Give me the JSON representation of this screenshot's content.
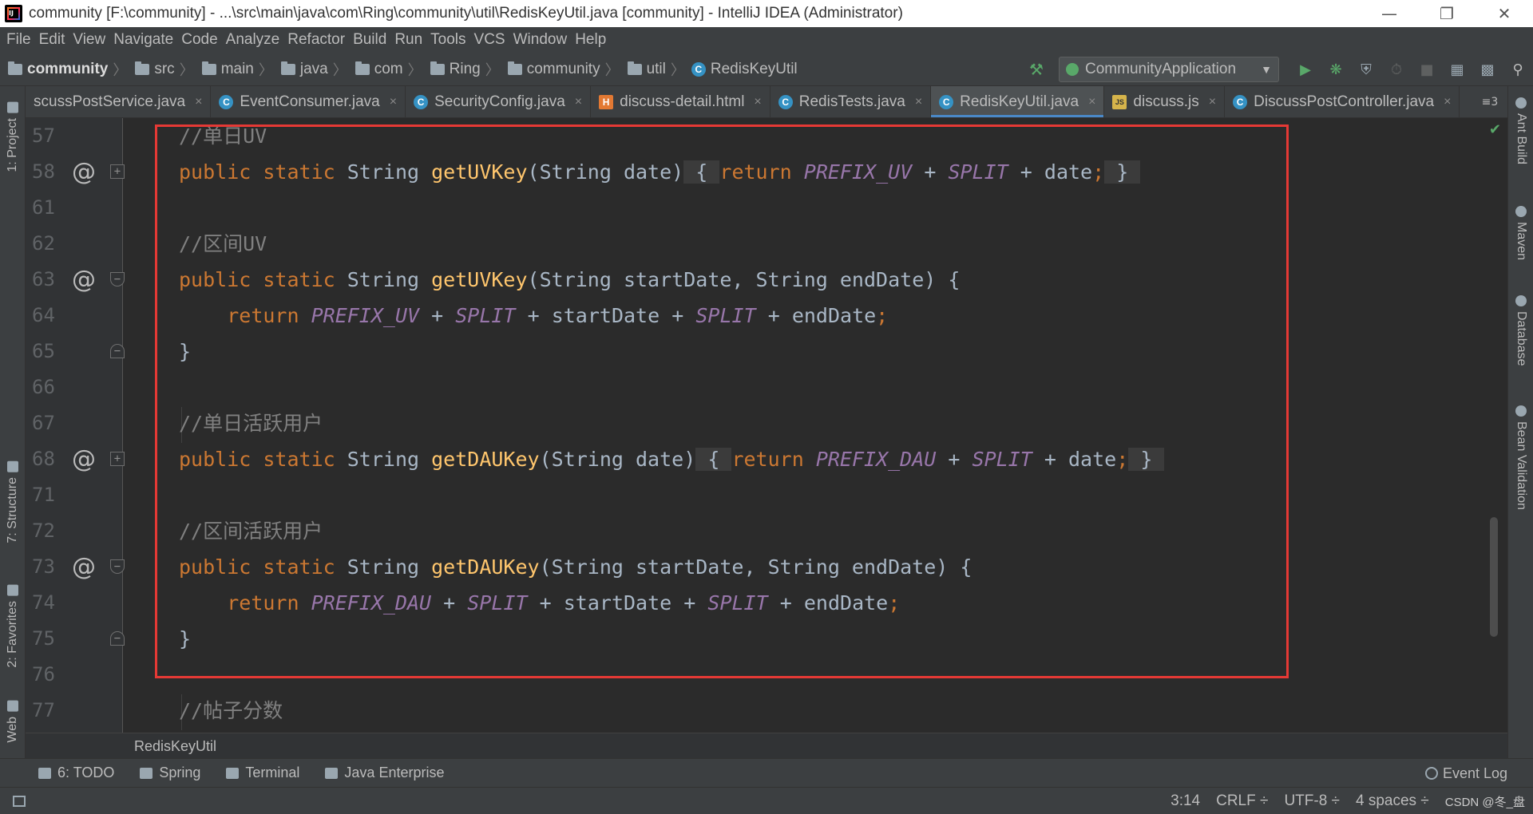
{
  "window": {
    "title": "community [F:\\community] - ...\\src\\main\\java\\com\\Ring\\community\\util\\RedisKeyUtil.java [community] - IntelliJ IDEA (Administrator)"
  },
  "menu": [
    "File",
    "Edit",
    "View",
    "Navigate",
    "Code",
    "Analyze",
    "Refactor",
    "Build",
    "Run",
    "Tools",
    "VCS",
    "Window",
    "Help"
  ],
  "breadcrumb": [
    "community",
    "src",
    "main",
    "java",
    "com",
    "Ring",
    "community",
    "util",
    "RedisKeyUtil"
  ],
  "run_config": "CommunityApplication",
  "tabs": [
    {
      "label": "scussPostService.java",
      "icon": "C",
      "type": "class",
      "close": "×"
    },
    {
      "label": "EventConsumer.java",
      "icon": "C",
      "type": "class",
      "close": "×"
    },
    {
      "label": "SecurityConfig.java",
      "icon": "C",
      "type": "class",
      "close": "×"
    },
    {
      "label": "discuss-detail.html",
      "icon": "H",
      "type": "html",
      "close": "×"
    },
    {
      "label": "RedisTests.java",
      "icon": "C",
      "type": "class",
      "close": "×"
    },
    {
      "label": "RedisKeyUtil.java",
      "icon": "C",
      "type": "class",
      "active": true,
      "close": "×"
    },
    {
      "label": "discuss.js",
      "icon": "JS",
      "type": "js",
      "close": "×"
    },
    {
      "label": "DiscussPostController.java",
      "icon": "C",
      "type": "class",
      "close": "×"
    }
  ],
  "tab_overflow": "≡3",
  "left_tools": [
    "1: Project",
    "7: Structure",
    "2: Favorites",
    "Web"
  ],
  "right_tools": [
    "Ant Build",
    "Maven",
    "Database",
    "Bean Validation"
  ],
  "editor": {
    "lines": [
      {
        "n": "57",
        "at": "",
        "fold": ""
      },
      {
        "n": "58",
        "at": "@",
        "fold": "+"
      },
      {
        "n": "61",
        "at": "",
        "fold": ""
      },
      {
        "n": "62",
        "at": "",
        "fold": ""
      },
      {
        "n": "63",
        "at": "@",
        "fold": "−"
      },
      {
        "n": "64",
        "at": "",
        "fold": ""
      },
      {
        "n": "65",
        "at": "",
        "fold": "−"
      },
      {
        "n": "66",
        "at": "",
        "fold": ""
      },
      {
        "n": "67",
        "at": "",
        "fold": ""
      },
      {
        "n": "68",
        "at": "@",
        "fold": "+"
      },
      {
        "n": "71",
        "at": "",
        "fold": ""
      },
      {
        "n": "72",
        "at": "",
        "fold": ""
      },
      {
        "n": "73",
        "at": "@",
        "fold": "−"
      },
      {
        "n": "74",
        "at": "",
        "fold": ""
      },
      {
        "n": "75",
        "at": "",
        "fold": "−"
      },
      {
        "n": "76",
        "at": "",
        "fold": ""
      },
      {
        "n": "77",
        "at": "",
        "fold": ""
      }
    ],
    "code": {
      "c57": "//单日UV",
      "c62": "//区间UV",
      "c67": "//单日活跃用户",
      "c72": "//区间活跃用户",
      "c77": "//帖子分数",
      "kw_public": "public",
      "kw_static": "static",
      "kw_return": "return",
      "type_string": "String",
      "fn_uv": "getUVKey",
      "fn_dau": "getDAUKey",
      "p_date": "(String date)",
      "p_range_open": "(String startDate, String endDate)",
      "c_prefix_uv": "PREFIX_UV",
      "c_prefix_dau": "PREFIX_DAU",
      "c_split": "SPLIT",
      "plus": "+",
      "date": "date",
      "startDate": "startDate",
      "endDate": "endDate",
      "semicolon": ";",
      "brace_open": "{",
      "brace_close": "}",
      "fold_open": "{",
      "fold_close": "}"
    }
  },
  "editor_breadcrumb": "RedisKeyUtil",
  "tool_windows": [
    {
      "label": "6: TODO"
    },
    {
      "label": "Spring"
    },
    {
      "label": "Terminal"
    },
    {
      "label": "Java Enterprise"
    }
  ],
  "event_log": "Event Log",
  "status": {
    "position": "3:14",
    "line_sep": "CRLF ÷",
    "encoding": "UTF-8 ÷",
    "indent": "4 spaces ÷",
    "watermark": "CSDN @冬_盘"
  }
}
